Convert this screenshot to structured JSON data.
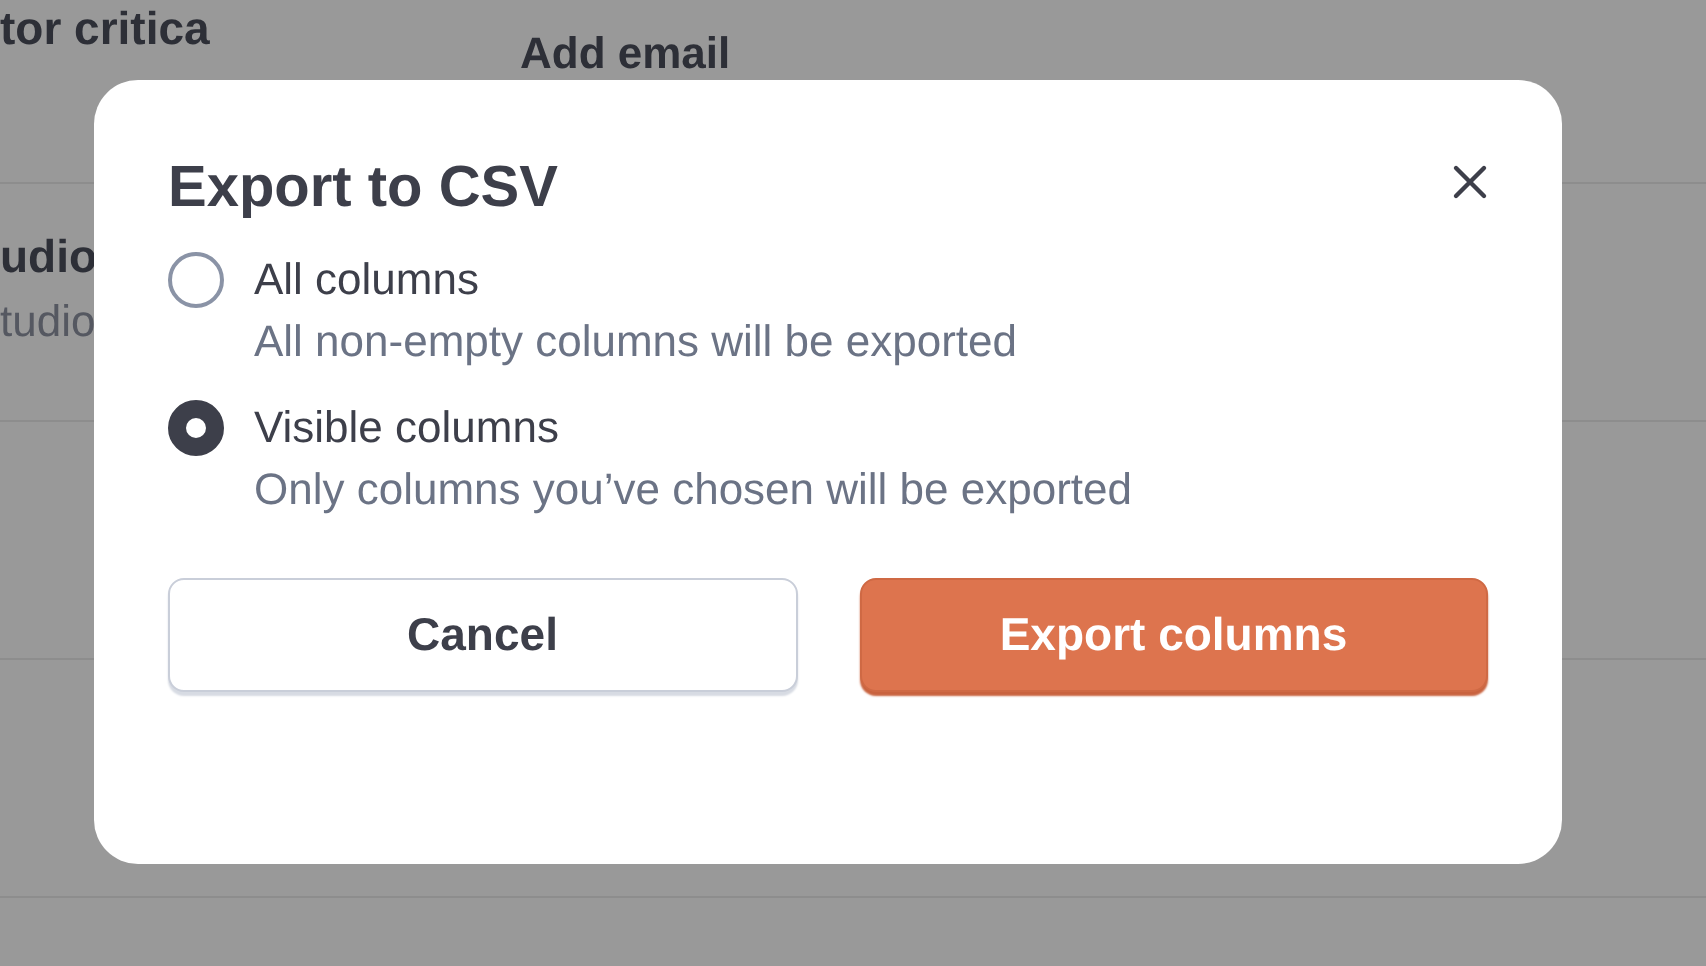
{
  "background": {
    "rows": [
      {
        "title": "tor critica",
        "action": "Add email"
      },
      {
        "title": "udio",
        "subtitle": "tudio"
      }
    ]
  },
  "dialog": {
    "title": "Export to CSV",
    "options": [
      {
        "label": "All columns",
        "description": "All non-empty columns will be exported",
        "selected": false
      },
      {
        "label": "Visible columns",
        "description": "Only columns you’ve chosen will be exported",
        "selected": true
      }
    ],
    "buttons": [
      {
        "label": "Cancel",
        "kind": "secondary"
      },
      {
        "label": "Export columns",
        "kind": "primary"
      }
    ]
  }
}
